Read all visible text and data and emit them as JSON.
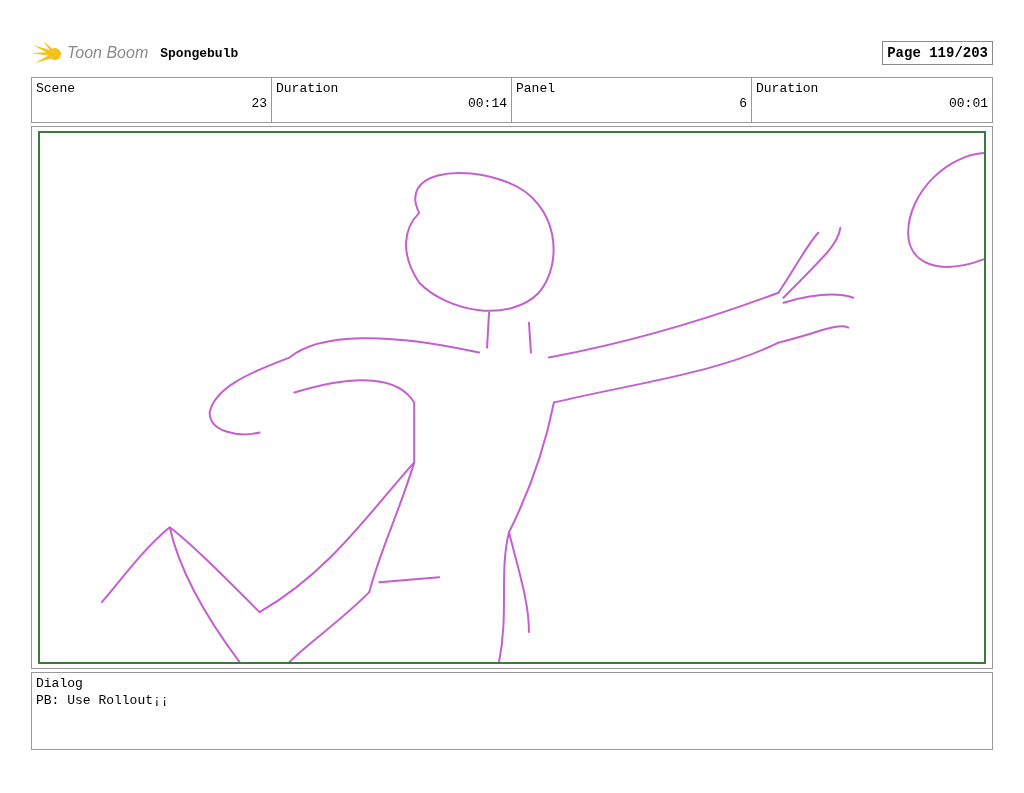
{
  "header": {
    "logo_text": "Toon Boom",
    "project": "Spongebulb",
    "page": "Page 119/203"
  },
  "info": [
    {
      "heading": "Scene",
      "entry": "23"
    },
    {
      "heading": "Duration",
      "entry": "00:14"
    },
    {
      "heading": "Panel",
      "entry": "6"
    },
    {
      "heading": "Duration",
      "entry": "00:01"
    }
  ],
  "dialog": {
    "label": "Dialog",
    "text": "PB: Use Rollout¡¡"
  }
}
